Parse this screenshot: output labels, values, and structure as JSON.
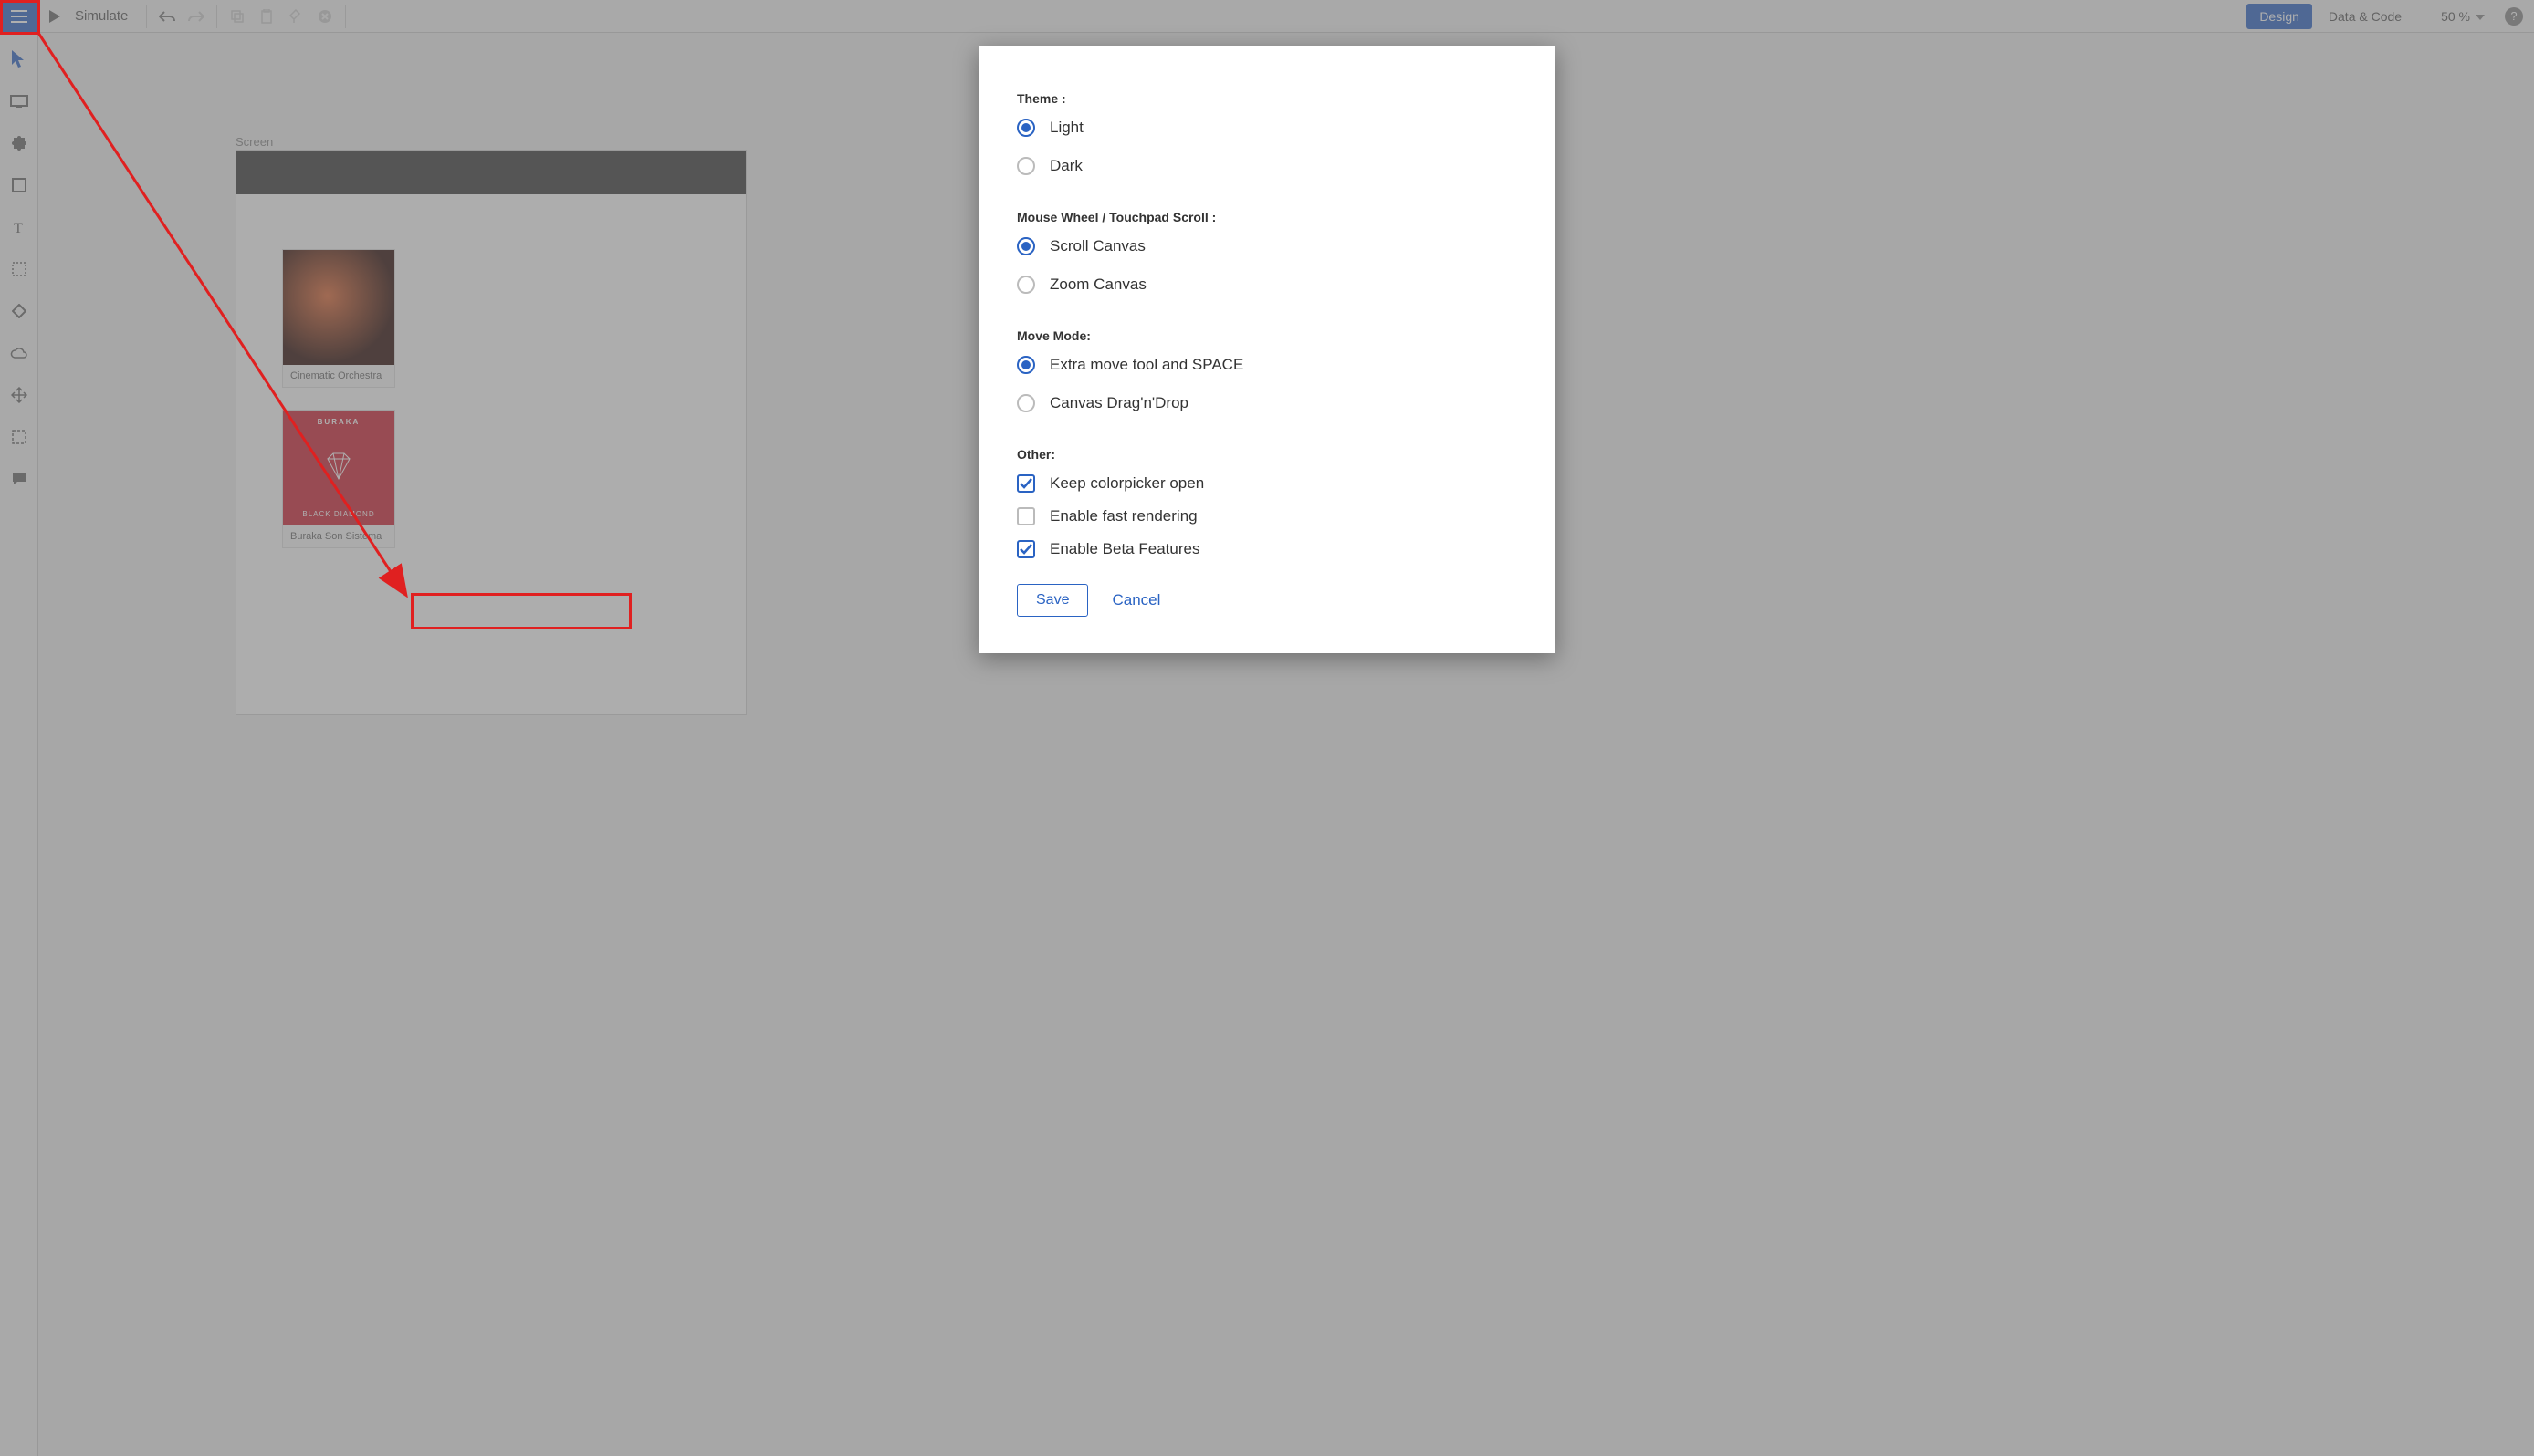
{
  "topbar": {
    "simulate_label": "Simulate",
    "design_label": "Design",
    "datacode_label": "Data & Code",
    "zoom_label": "50 %"
  },
  "canvas": {
    "screen_label": "Screen",
    "albums": [
      {
        "caption": "Cinematic Orchestra"
      },
      {
        "caption": "Buraka Son Sistema",
        "art_title": "BURAKA",
        "art_sub": "BLACK DIAMOND"
      }
    ]
  },
  "modal": {
    "sections": {
      "theme": {
        "title": "Theme :",
        "options": [
          {
            "label": "Light",
            "selected": true
          },
          {
            "label": "Dark",
            "selected": false
          }
        ]
      },
      "scroll": {
        "title": "Mouse Wheel / Touchpad Scroll :",
        "options": [
          {
            "label": "Scroll Canvas",
            "selected": true
          },
          {
            "label": "Zoom Canvas",
            "selected": false
          }
        ]
      },
      "move": {
        "title": "Move Mode:",
        "options": [
          {
            "label": "Extra move tool and SPACE",
            "selected": true
          },
          {
            "label": "Canvas Drag'n'Drop",
            "selected": false
          }
        ]
      },
      "other": {
        "title": "Other:",
        "options": [
          {
            "label": "Keep colorpicker open",
            "checked": true
          },
          {
            "label": "Enable fast rendering",
            "checked": false
          },
          {
            "label": "Enable Beta Features",
            "checked": true
          }
        ]
      }
    },
    "save_label": "Save",
    "cancel_label": "Cancel"
  }
}
